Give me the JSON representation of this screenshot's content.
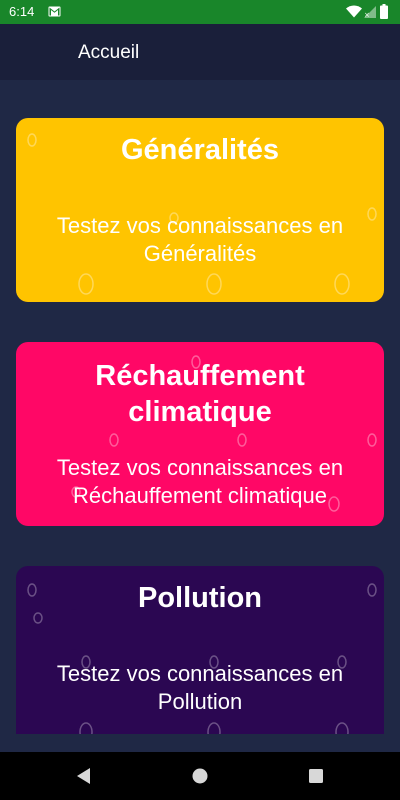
{
  "status_bar": {
    "time": "6:14",
    "icons": [
      "gmail-icon",
      "wifi-icon",
      "signal-icon",
      "battery-icon"
    ],
    "color": "#19862a"
  },
  "app_bar": {
    "title": "Accueil"
  },
  "cards": [
    {
      "title": "Généralités",
      "description_line1": "Testez vos connaissances en",
      "description_line2": "Généralités",
      "color": "#ffc400"
    },
    {
      "title_line1": "Réchauffement",
      "title_line2": "climatique",
      "description_line1": "Testez vos connaissances en",
      "description_line2": "Réchauffement climatique",
      "color": "#ff0766"
    },
    {
      "title": "Pollution",
      "description_line1": "Testez vos connaissances en",
      "description_line2": "Pollution",
      "color": "#2b0752"
    }
  ],
  "nav_bar": {
    "buttons": [
      "back-icon",
      "home-icon",
      "recents-icon"
    ]
  }
}
